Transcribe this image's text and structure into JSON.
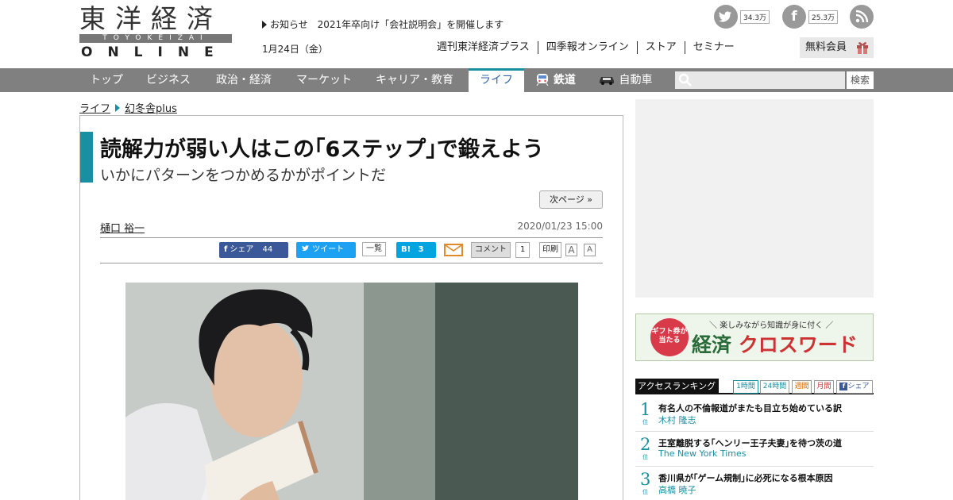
{
  "header": {
    "logo_kanji": "東洋経済",
    "logo_romaji": "TOYOKEIZAI",
    "logo_online": "ONLINE",
    "notice_label": "お知らせ",
    "notice_text": "2021年卒向け「会社説明会」を開催します",
    "date": "1月24日（金）",
    "top_links": [
      "週刊東洋経済プラス",
      "四季報オンライン",
      "ストア",
      "セミナー"
    ],
    "member_label": "無料会員",
    "twitter_count": "34.3万",
    "facebook_count": "25.3万"
  },
  "nav": {
    "items": [
      "トップ",
      "ビジネス",
      "政治・経済",
      "マーケット",
      "キャリア・教育",
      "ライフ",
      "鉄道",
      "自動車"
    ],
    "active_index": 5,
    "search_label": "検索",
    "search_placeholder": ""
  },
  "breadcrumb": [
    "ライフ",
    "幻冬舎plus"
  ],
  "article": {
    "title": "読解力が弱い人はこの｢6ステップ｣で鍛えよう",
    "subtitle": "いかにパターンをつかめるかがポイントだ",
    "next_page": "次ページ »",
    "author": "樋口 裕一",
    "date": "2020/01/23 15:00",
    "share": {
      "facebook_label": "シェア",
      "facebook_count": "44",
      "tweet_label": "ツイート",
      "list_label": "一覧",
      "hatena_label": "B!",
      "hatena_count": "3",
      "comment_label": "コメント",
      "comment_count": "1",
      "print_label": "印刷",
      "font_small": "A",
      "font_large": "A"
    }
  },
  "sidebar": {
    "banner_badge": "ギフト券が当たる",
    "banner_top": "＼ 楽しみながら知識が身に付く ／",
    "banner_main": "経済",
    "banner_main_red": "クロスワード",
    "ranking_title": "アクセスランキング",
    "ranking_tabs": [
      "1時間",
      "24時間",
      "週間",
      "月間",
      "シェア"
    ],
    "ranking_rank_suffix": "位",
    "ranking": [
      {
        "rank": "1",
        "title": "有名人の不倫報道がまたも目立ち始めている訳",
        "author": "木村 隆志"
      },
      {
        "rank": "2",
        "title": "王室離脱する｢ヘンリー王子夫妻｣を待つ茨の道",
        "author": "The New York Times"
      },
      {
        "rank": "3",
        "title": "香川県が｢ゲーム規制｣に必死になる根本原因",
        "author": "高橋 暁子"
      }
    ]
  },
  "colors": {
    "accent": "#1a8fa0",
    "nav_bg": "#808080",
    "facebook": "#3b5998",
    "twitter": "#1da1f2",
    "hatena": "#00a4de"
  }
}
